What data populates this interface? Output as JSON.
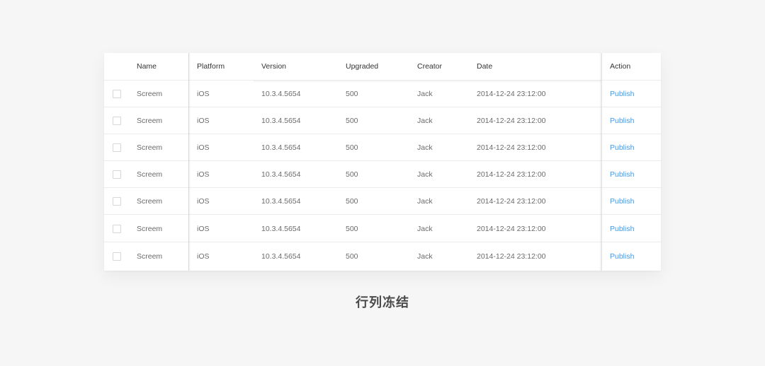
{
  "table": {
    "columns": {
      "name": "Name",
      "platform": "Platform",
      "version": "Version",
      "upgraded": "Upgraded",
      "creator": "Creator",
      "date": "Date",
      "action": "Action"
    },
    "rows": [
      {
        "name": "Screem",
        "platform": "iOS",
        "version": "10.3.4.5654",
        "upgraded": "500",
        "creator": "Jack",
        "date": "2014-12-24 23:12:00",
        "action": "Publish"
      },
      {
        "name": "Screem",
        "platform": "iOS",
        "version": "10.3.4.5654",
        "upgraded": "500",
        "creator": "Jack",
        "date": "2014-12-24 23:12:00",
        "action": "Publish"
      },
      {
        "name": "Screem",
        "platform": "iOS",
        "version": "10.3.4.5654",
        "upgraded": "500",
        "creator": "Jack",
        "date": "2014-12-24 23:12:00",
        "action": "Publish"
      },
      {
        "name": "Screem",
        "platform": "iOS",
        "version": "10.3.4.5654",
        "upgraded": "500",
        "creator": "Jack",
        "date": "2014-12-24 23:12:00",
        "action": "Publish"
      },
      {
        "name": "Screem",
        "platform": "iOS",
        "version": "10.3.4.5654",
        "upgraded": "500",
        "creator": "Jack",
        "date": "2014-12-24 23:12:00",
        "action": "Publish"
      },
      {
        "name": "Screem",
        "platform": "iOS",
        "version": "10.3.4.5654",
        "upgraded": "500",
        "creator": "Jack",
        "date": "2014-12-24 23:12:00",
        "action": "Publish"
      },
      {
        "name": "Screem",
        "platform": "iOS",
        "version": "10.3.4.5654",
        "upgraded": "500",
        "creator": "Jack",
        "date": "2014-12-24 23:12:00",
        "action": "Publish"
      }
    ]
  },
  "caption": "行列冻结",
  "colors": {
    "link": "#3a9bf0",
    "background": "#f6f6f7"
  }
}
